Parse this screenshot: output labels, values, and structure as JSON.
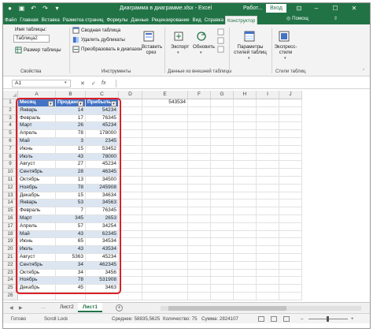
{
  "titlebar": {
    "title": "Диаграмма в диаграмме.xlsx  -  Excel",
    "work": "Работ...",
    "login": "Вход"
  },
  "tabs": [
    "Файл",
    "Главная",
    "Вставка",
    "Разметка страниц",
    "Формулы",
    "Данные",
    "Рецензирование",
    "Вид",
    "Справка",
    "Конструктор"
  ],
  "tabs_extra": {
    "help": "Помощ",
    "share": ""
  },
  "ribbon": {
    "props": {
      "label_name": "Имя таблицы:",
      "name_value": "Таблица2",
      "resize": "Размер таблицы",
      "group": "Свойства"
    },
    "tools": {
      "pivot": "Сводная таблица",
      "dups": "Удалить дубликаты",
      "range": "Преобразовать в диапазон",
      "slicer": "Вставить срез",
      "group": "Инструменты"
    },
    "external": {
      "export": "Экспорт",
      "refresh": "Обновить",
      "group": "Данные из внешней таблицы"
    },
    "options": {
      "params": "Параметры стилей таблиц",
      "group": ""
    },
    "styles": {
      "express": "Экспресс-стили",
      "group": "Стили таблиц"
    }
  },
  "formula": {
    "namebox": "A1",
    "value": ""
  },
  "columns": [
    "A",
    "B",
    "C",
    "D",
    "E",
    "F",
    "G",
    "H",
    "I",
    "J"
  ],
  "table": {
    "headers": [
      "Месяц",
      "Продано",
      "Прибыль"
    ],
    "rows": [
      [
        "Январь",
        "14",
        "54234"
      ],
      [
        "Февраль",
        "17",
        "76345"
      ],
      [
        "Март",
        "26",
        "45234"
      ],
      [
        "Апрель",
        "78",
        "178000"
      ],
      [
        "Май",
        "3",
        "2345"
      ],
      [
        "Июнь",
        "15",
        "53452"
      ],
      [
        "Июль",
        "43",
        "78000"
      ],
      [
        "Август",
        "27",
        "45234"
      ],
      [
        "Сентябрь",
        "28",
        "46345"
      ],
      [
        "Октябрь",
        "13",
        "34500"
      ],
      [
        "Ноябрь",
        "78",
        "245908"
      ],
      [
        "Декабрь",
        "15",
        "34634"
      ],
      [
        "Январь",
        "53",
        "34563"
      ],
      [
        "Февраль",
        "7",
        "76345"
      ],
      [
        "Март",
        "345",
        "2653"
      ],
      [
        "Апрель",
        "57",
        "34254"
      ],
      [
        "Май",
        "43",
        "62345"
      ],
      [
        "Июнь",
        "65",
        "34534"
      ],
      [
        "Июль",
        "43",
        "43534"
      ],
      [
        "Август",
        "5363",
        "45234"
      ],
      [
        "Сентябрь",
        "34",
        "462345"
      ],
      [
        "Октябрь",
        "34",
        "3456"
      ],
      [
        "Ноябрь",
        "78",
        "531908"
      ],
      [
        "Декабрь",
        "45",
        "3463"
      ]
    ]
  },
  "e1_value": "543534",
  "sheets": [
    "Лист2",
    "Лист1"
  ],
  "status": {
    "ready": "Готово",
    "scroll": "Scroll Lock",
    "avg": "Среднее: 58835,5625",
    "count": "Количество: 75",
    "sum": "Сумма: 2824107"
  }
}
